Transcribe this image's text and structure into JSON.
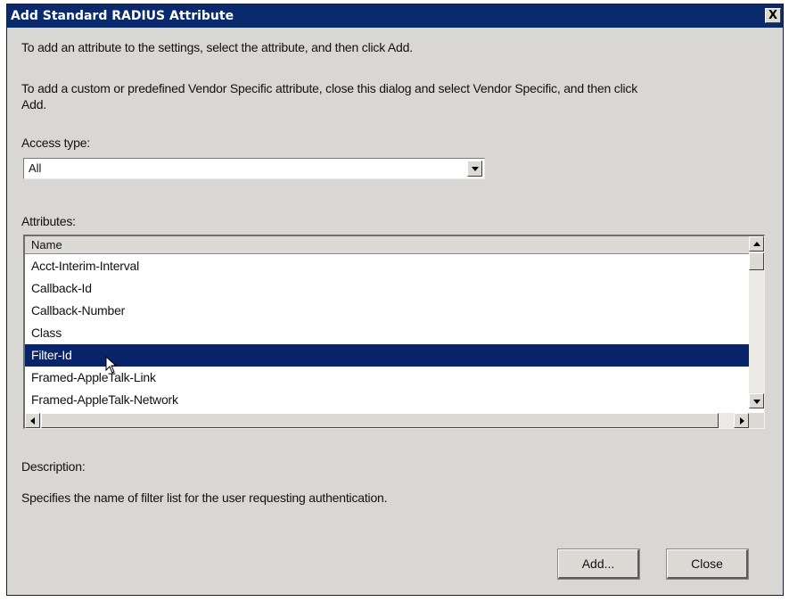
{
  "dialog": {
    "title": "Add Standard RADIUS Attribute",
    "close_glyph": "X"
  },
  "instructions": {
    "line1": "To add an attribute to the settings, select the attribute, and then click Add.",
    "line2a": "To add a custom or predefined Vendor Specific attribute, close this dialog and select Vendor Specific, and then click",
    "line2b": "Add."
  },
  "access_type": {
    "label": "Access type:",
    "selected": "All"
  },
  "attributes": {
    "label": "Attributes:",
    "column_header": "Name",
    "rows": [
      "Acct-Interim-Interval",
      "Callback-Id",
      "Callback-Number",
      "Class",
      "Filter-Id",
      "Framed-AppleTalk-Link",
      "Framed-AppleTalk-Network"
    ],
    "selected_row": "Filter-Id"
  },
  "description": {
    "label": "Description:",
    "text": "Specifies the name of filter list for the user requesting authentication."
  },
  "buttons": {
    "add": "Add...",
    "close": "Close"
  },
  "colors": {
    "titlebar": "#0a2a6e",
    "selection": "#0a246a",
    "dialog_bg": "#d8d7d4"
  }
}
